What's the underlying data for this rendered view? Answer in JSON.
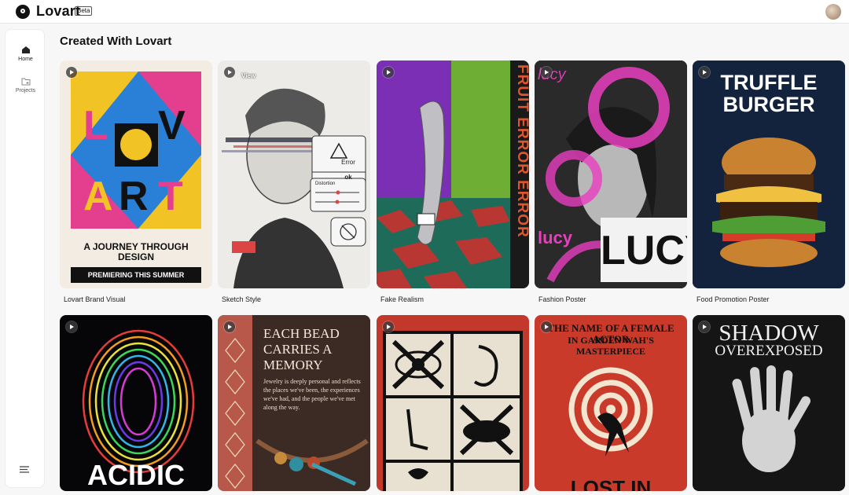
{
  "app": {
    "name": "Lovart",
    "badge": "Beta"
  },
  "sidebar": {
    "items": [
      {
        "label": "Home"
      },
      {
        "label": "Projects"
      }
    ]
  },
  "section": {
    "title": "Created With Lovart"
  },
  "row1": [
    {
      "caption": "Lovart Brand Visual",
      "poster_line1": "A JOURNEY THROUGH",
      "poster_line2": "DESIGN",
      "poster_bar": "PREMIERING THIS SUMMER"
    },
    {
      "caption": "Sketch Style",
      "view_label": "View",
      "dialog_text": "Error",
      "dialog_button": "ok",
      "slider_label": "Distortion"
    },
    {
      "caption": "Fake Realism",
      "side_text": "FRUIT ERROR ERROR"
    },
    {
      "caption": "Fashion Poster",
      "big_text": "LUCY",
      "small_text": "lucy"
    },
    {
      "caption": "Food Promotion Poster",
      "headline1": "TRUFFLE",
      "headline2": "BURGER"
    }
  ],
  "row2": [
    {
      "headline": "ACIDIC"
    },
    {
      "headline1": "EACH BEAD",
      "headline2": "CARRIES A",
      "headline3": "MEMORY",
      "body": "Jewelry is deeply personal and reflects the places we've been, the experiences we've had, and the people we've met along the way."
    },
    {},
    {
      "top_line1": "THE NAME OF A FEMALE ACTOR",
      "top_line2": "IN GARDEN WAH'S MASTERPIECE",
      "bottom": "LOST IN"
    },
    {
      "headline1": "SHADOW",
      "headline2": "OVEREXPOSED"
    }
  ],
  "colors": {
    "accent": "#111111",
    "background": "#f7f7f7"
  }
}
